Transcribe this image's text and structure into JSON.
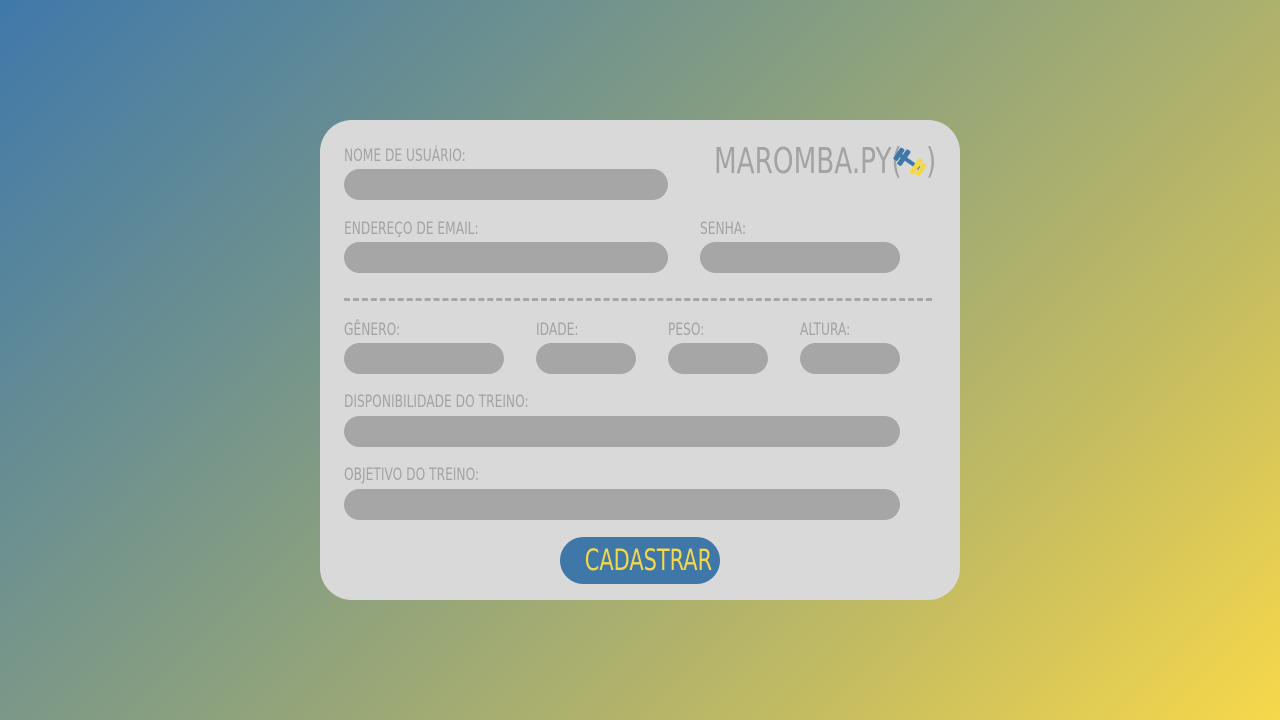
{
  "brand": {
    "title": "MAROMBA.PY(",
    "closing": ")",
    "icon": "dumbbell-icon"
  },
  "form": {
    "username_label": "NOME DE USUÁRIO:",
    "username_value": "",
    "email_label": "ENDEREÇO DE EMAIL:",
    "email_value": "",
    "password_label": "SENHA:",
    "password_value": "",
    "gender_label": "GÊNERO:",
    "gender_value": "",
    "age_label": "IDADE:",
    "age_value": "",
    "weight_label": "PESO:",
    "weight_value": "",
    "height_label": "ALTURA:",
    "height_value": "",
    "availability_label": "DISPONIBILIDADE DO TREINO:",
    "availability_value": "",
    "goal_label": "OBJETIVO DO TREINO:",
    "goal_value": "",
    "submit_label": "CADASTRAR"
  },
  "colors": {
    "card_background": "#d9d9d9",
    "field_background": "#a6a6a6",
    "label_text": "#a3a3a3",
    "button_background": "#3f77a8",
    "button_text": "#f4d84a",
    "gradient_start": "#3f78aa",
    "gradient_end": "#f7d84a"
  }
}
